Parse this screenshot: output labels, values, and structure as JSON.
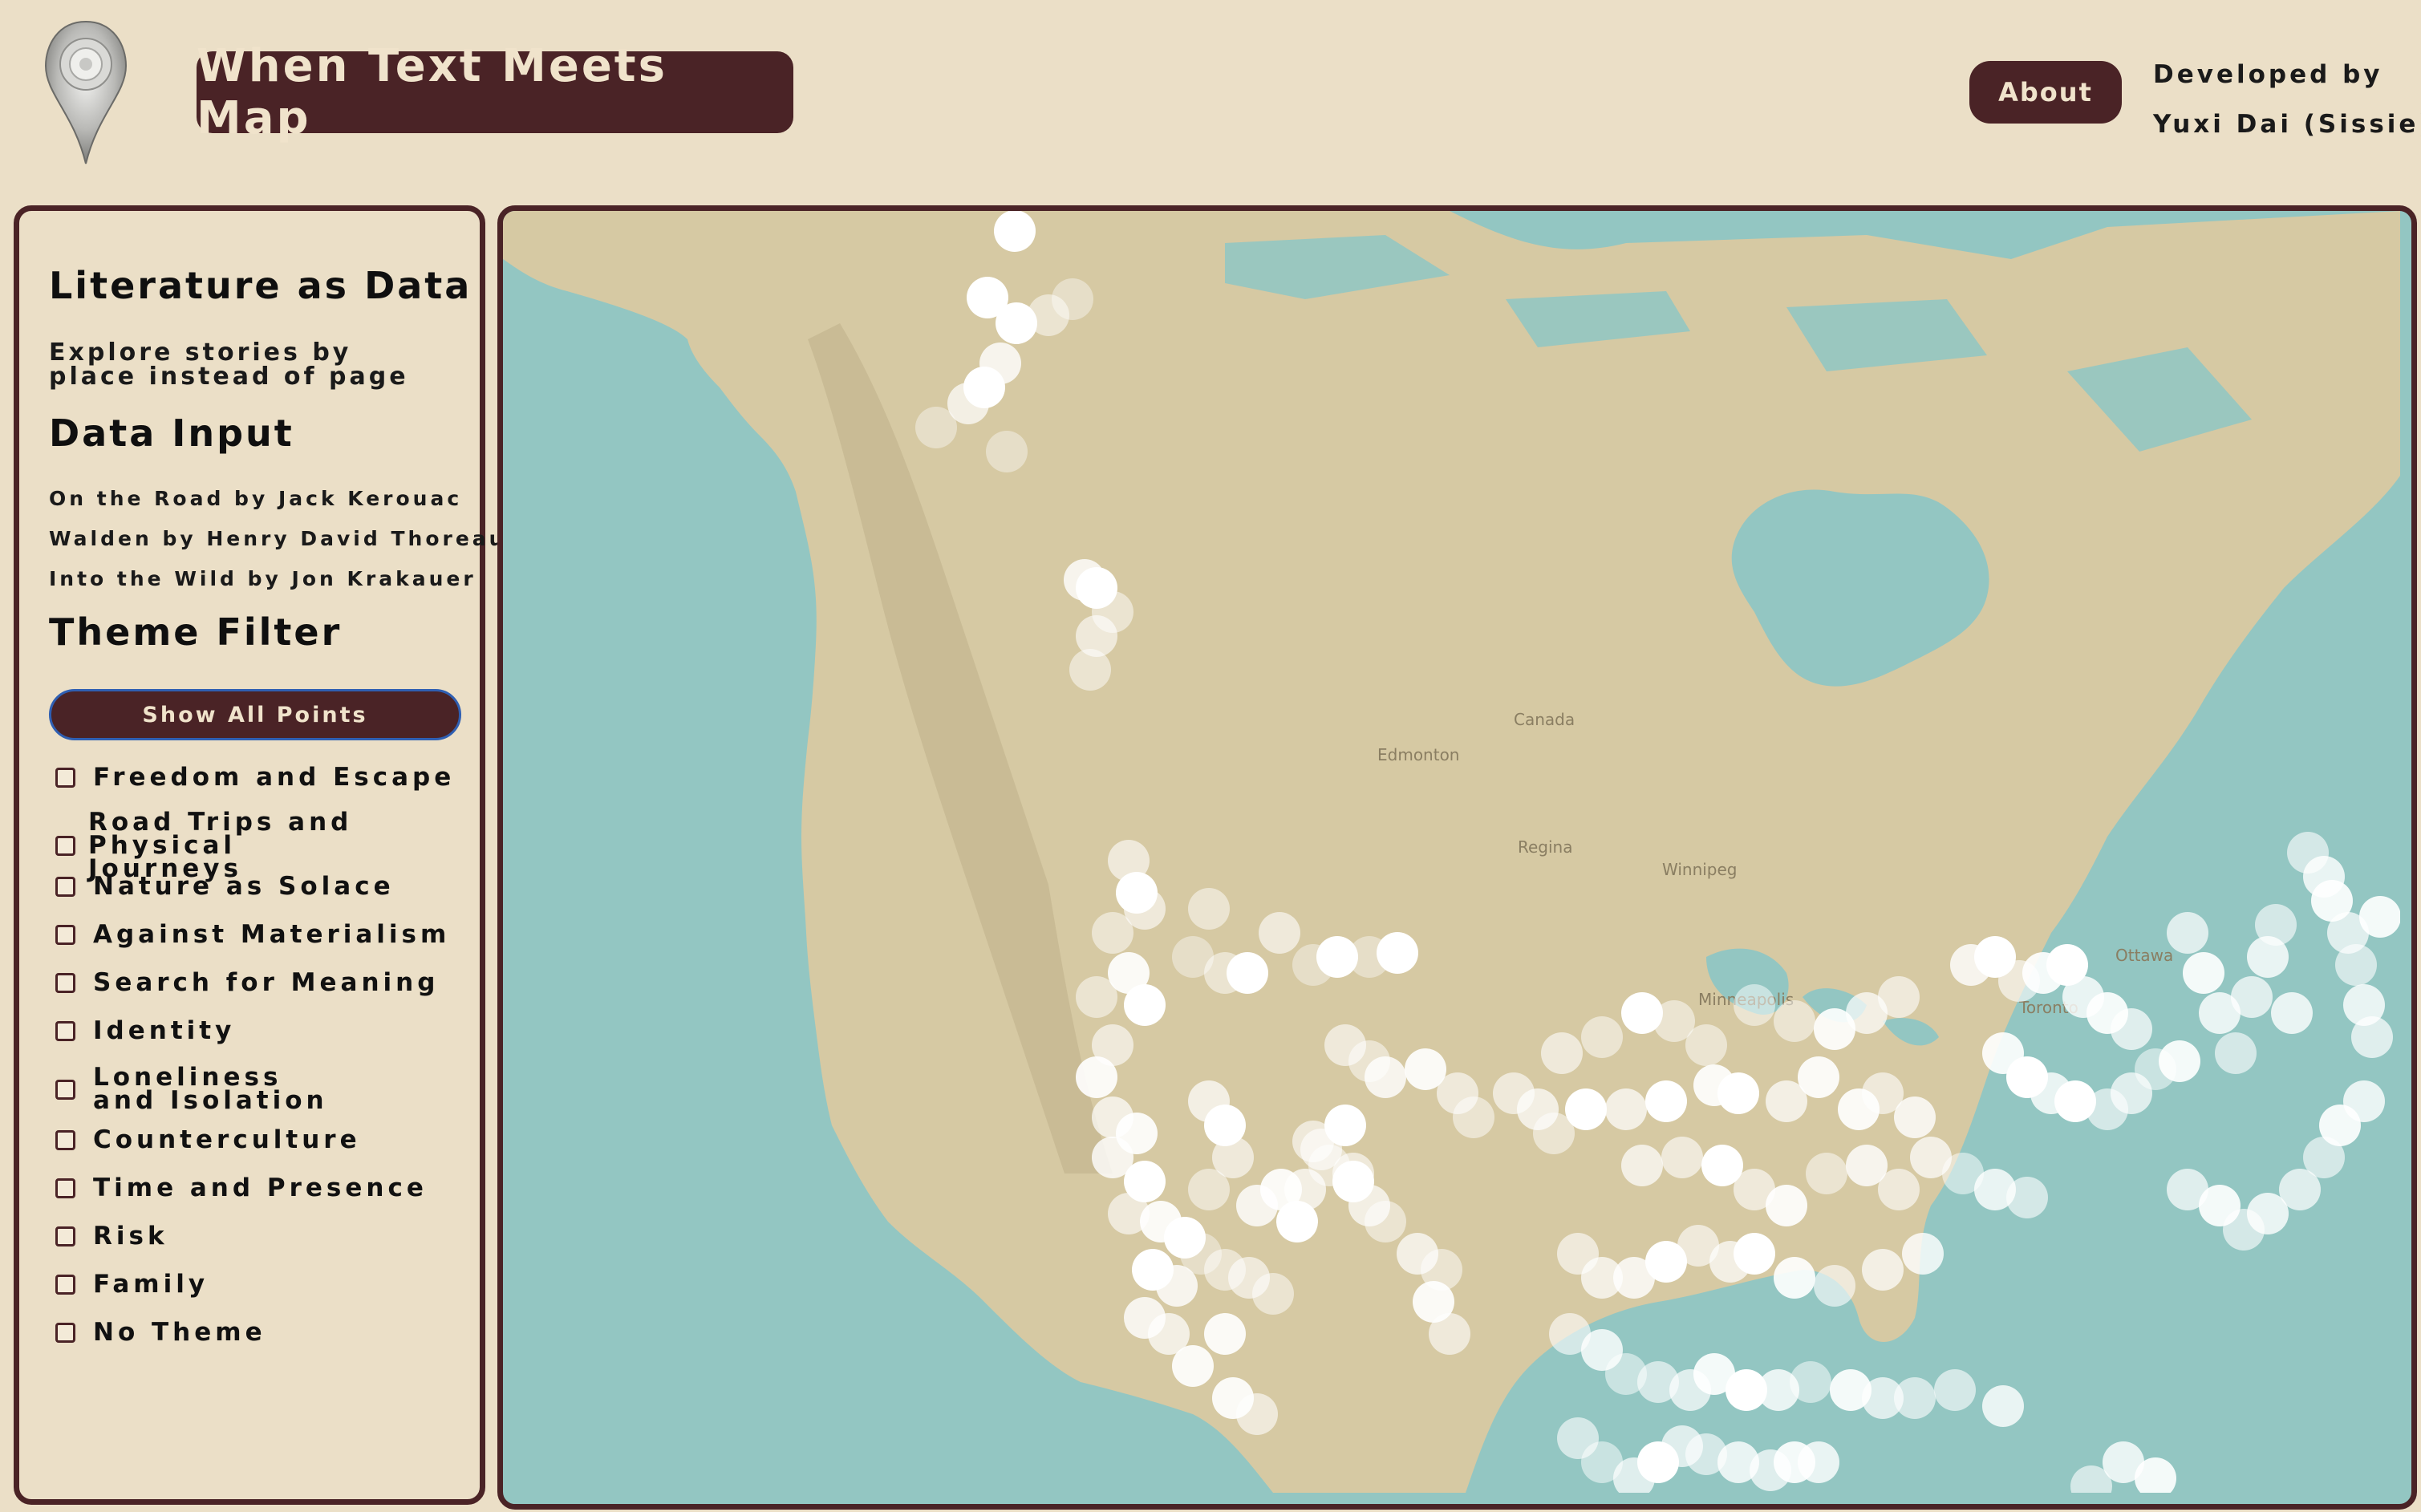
{
  "header": {
    "title": "When Text Meets Map",
    "about_label": "About",
    "developer_line1": "Developed by",
    "developer_line2": "Yuxi Dai (Sissie)"
  },
  "sidebar": {
    "intro_title": "Literature as Data",
    "intro_text": "Explore stories by place instead of page",
    "data_title": "Data Input",
    "books": [
      "On the Road by Jack Kerouac",
      "Walden by Henry David Thoreau",
      "Into the Wild by Jon Krakauer"
    ],
    "filter_title": "Theme Filter",
    "show_all_label": "Show All Points",
    "themes": [
      "Freedom and Escape",
      "Road Trips and Physical Journeys",
      "Nature as Solace",
      "Against Materialism",
      "Search for Meaning",
      "Identity",
      "Loneliness and Isolation",
      "Counterculture",
      "Time and Presence",
      "Risk",
      "Family",
      "No Theme"
    ]
  },
  "map": {
    "labels": [
      "Canada",
      "Edmonton",
      "Regina",
      "Winnipeg",
      "Minneapolis",
      "Toronto",
      "Ottawa"
    ]
  }
}
